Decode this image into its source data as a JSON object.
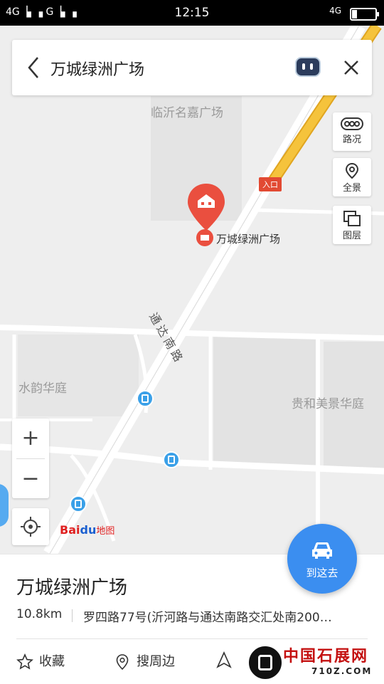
{
  "status_bar": {
    "left": "4G▕▖▗  G▕▖▗",
    "time": "12:15",
    "right": "4G"
  },
  "search": {
    "query": "万城绿洲广场"
  },
  "map_labels": {
    "poi_top": "临沂名嘉广场",
    "entrance": "入口",
    "place": "万城绿洲广场",
    "road": "通达南路",
    "left_area": "水韵华庭",
    "right_area": "贵和美景华庭"
  },
  "tools": {
    "traffic": "路况",
    "panorama": "全景",
    "layers": "图层"
  },
  "zoom": {
    "in": "+",
    "out": "−"
  },
  "logo": {
    "part1": "Bai",
    "part2": "du",
    "part3": "地图"
  },
  "place": {
    "name": "万城绿洲广场",
    "distance": "10.8km",
    "address": "罗四路77号(沂河路与通达南路交汇处南200…"
  },
  "actions": {
    "favorite": "收藏",
    "nearby": "搜周边"
  },
  "go_button": "到这去",
  "watermark": {
    "title": "中国石展网",
    "url": "710Z.COM"
  },
  "colors": {
    "accent": "#3b8ef0",
    "pin": "#ea4f3f",
    "expressway": "#f5c33c"
  }
}
